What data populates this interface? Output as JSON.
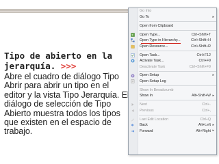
{
  "slide": {
    "title": "Tipo de abierto en la jerarquía.",
    "title_arrows": ">>>",
    "body": "Abre el cuadro de diálogo Tipo Abrir para abrir un tipo en el editor y la vista Tipo Jerarquía. El diálogo de selección de Tipo Abierto muestra todos los tipos que existen en el espacio de trabajo."
  },
  "colors": {
    "accent": "#e0403a",
    "highlight_underline": "#d02018"
  },
  "menu": {
    "items": [
      {
        "label": "Go Into",
        "shortcut": "",
        "icon": "",
        "disabled": true
      },
      {
        "label": "Go To",
        "shortcut": "",
        "icon": "",
        "submenu": true
      },
      {
        "sep": true
      },
      {
        "label": "Open from Clipboard",
        "shortcut": "",
        "icon": ""
      },
      {
        "sep": true
      },
      {
        "label": "Open Type...",
        "shortcut": "Ctrl+Shift+T",
        "icon": "open-type-icon"
      },
      {
        "label": "Open Type in Hierarchy...",
        "shortcut": "Ctrl+Shift+H",
        "icon": "hierarchy-icon",
        "underline": true
      },
      {
        "label": "Open Resource...",
        "shortcut": "Ctrl+Shift+R",
        "icon": "resource-icon"
      },
      {
        "sep": true
      },
      {
        "label": "Open Task...",
        "shortcut": "Ctrl+F12",
        "icon": "task-icon"
      },
      {
        "label": "Activate Task...",
        "shortcut": "Ctrl+F9",
        "icon": "activate-task-icon"
      },
      {
        "label": "Deactivate Task",
        "shortcut": "Ctrl+Shift+F9",
        "icon": "",
        "disabled": true
      },
      {
        "sep": true
      },
      {
        "label": "Open Setup",
        "shortcut": "",
        "icon": "setup-icon",
        "submenu": true
      },
      {
        "label": "Open Setup Log",
        "shortcut": "",
        "icon": "setup-log-icon"
      },
      {
        "sep": true
      },
      {
        "label": "Show In Breadcrumb",
        "shortcut": "",
        "icon": "",
        "disabled": true
      },
      {
        "label": "Show In",
        "shortcut": "Alt+Shift+W",
        "icon": "",
        "submenu": true
      },
      {
        "sep": true
      },
      {
        "label": "Next",
        "shortcut": "Ctrl+.",
        "icon": "next-icon",
        "disabled": true
      },
      {
        "label": "Previous",
        "shortcut": "Ctrl+,",
        "icon": "previous-icon",
        "disabled": true
      },
      {
        "sep": true
      },
      {
        "label": "Last Edit Location",
        "shortcut": "Ctrl+Q",
        "icon": "last-edit-icon",
        "disabled": true
      },
      {
        "label": "Back",
        "shortcut": "Alt+Left",
        "icon": "back-icon",
        "submenu": true
      },
      {
        "label": "Forward",
        "shortcut": "Alt+Right",
        "icon": "forward-icon",
        "submenu": true
      }
    ]
  }
}
